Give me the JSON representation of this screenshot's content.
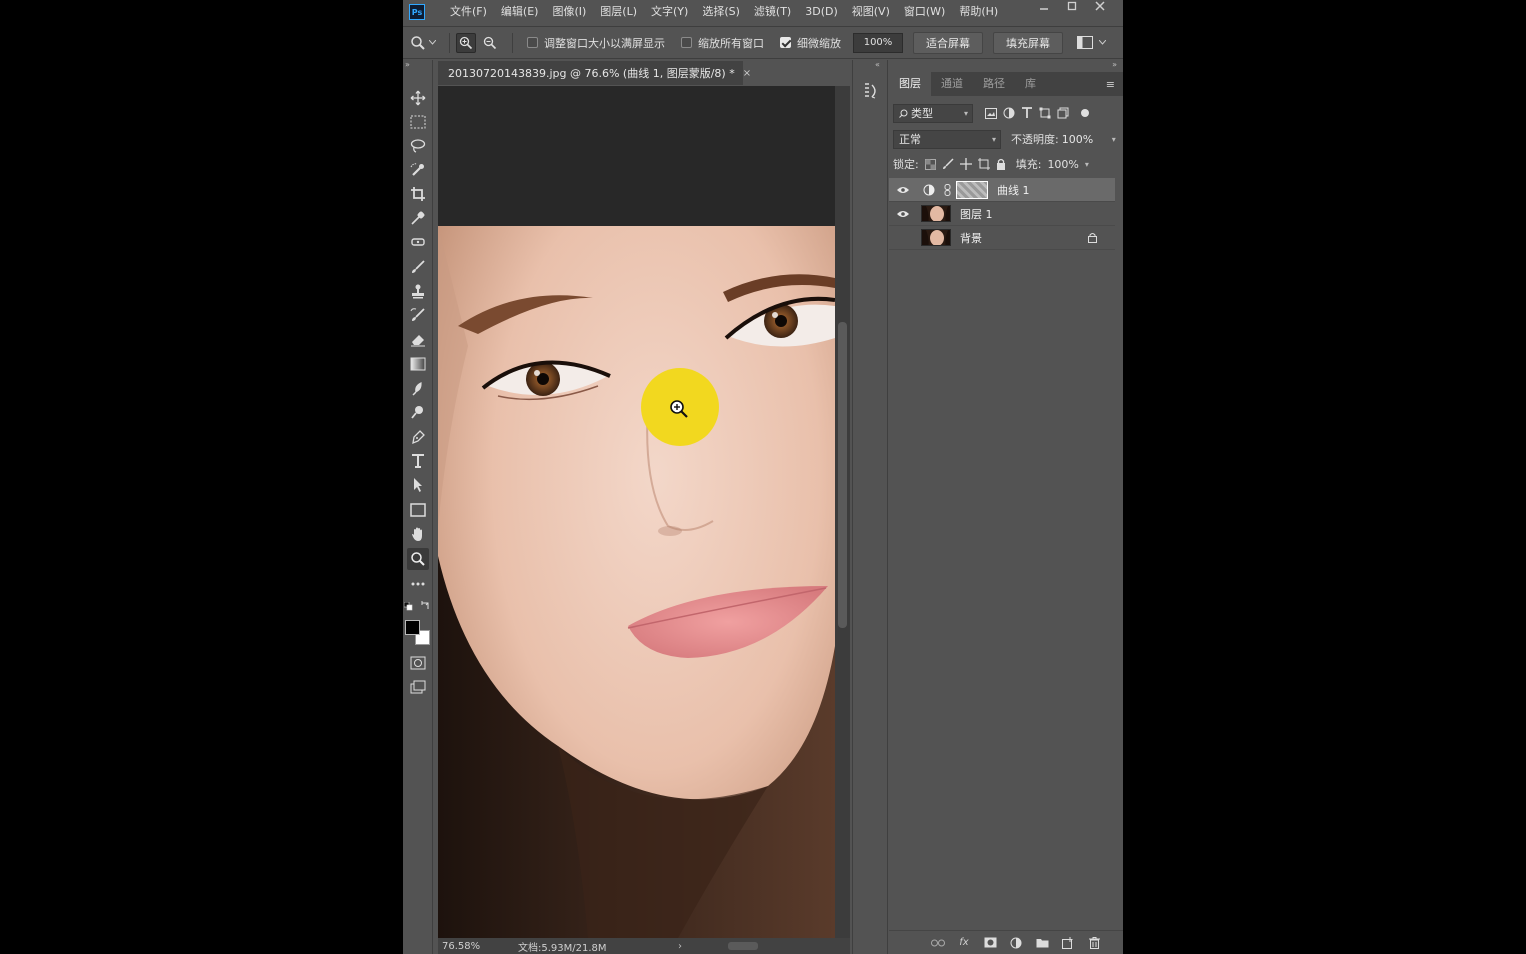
{
  "app": {
    "logo": "Ps",
    "menu": [
      "文件(F)",
      "编辑(E)",
      "图像(I)",
      "图层(L)",
      "文字(Y)",
      "选择(S)",
      "滤镜(T)",
      "3D(D)",
      "视图(V)",
      "窗口(W)",
      "帮助(H)"
    ],
    "window_controls": [
      "minimize",
      "restore",
      "close"
    ]
  },
  "options_bar": {
    "tool_icon": "zoom-icon",
    "resize_windows_label": "调整窗口大小以满屏显示",
    "resize_windows_checked": false,
    "zoom_all_windows_label": "缩放所有窗口",
    "zoom_all_windows_checked": false,
    "scrubby_zoom_label": "细微缩放",
    "scrubby_zoom_checked": true,
    "zoom_percent": "100%",
    "fit_screen_label": "适合屏幕",
    "fill_screen_label": "填充屏幕"
  },
  "document": {
    "tab_title": "20130720143839.jpg @ 76.6% (曲线 1, 图层蒙版/8) *",
    "close_label": "×",
    "status_zoom": "76.58%",
    "status_doc": "文档:5.93M/21.8M"
  },
  "layers_panel": {
    "tabs": [
      "图层",
      "通道",
      "路径",
      "库"
    ],
    "active_tab": 0,
    "filter_label": "类型",
    "blend_mode": "正常",
    "opacity_label": "不透明度:",
    "opacity_value": "100%",
    "lock_label": "锁定:",
    "fill_label": "填充:",
    "fill_value": "100%",
    "layers": [
      {
        "name": "曲线 1",
        "visible": true,
        "selected": true,
        "type": "adjustment"
      },
      {
        "name": "图层 1",
        "visible": true,
        "selected": false,
        "type": "pixel"
      },
      {
        "name": "背景",
        "visible": false,
        "selected": false,
        "type": "background",
        "locked": true
      }
    ],
    "bottom_icons": [
      "link-icon",
      "fx-icon",
      "mask-icon",
      "adjustment-icon",
      "group-icon",
      "new-layer-icon",
      "trash-icon"
    ],
    "fx_label": "fx"
  },
  "colors": {
    "ui_bg": "#535353",
    "canvas_bg": "#282828",
    "cursor_highlight": "#f2d81f"
  }
}
